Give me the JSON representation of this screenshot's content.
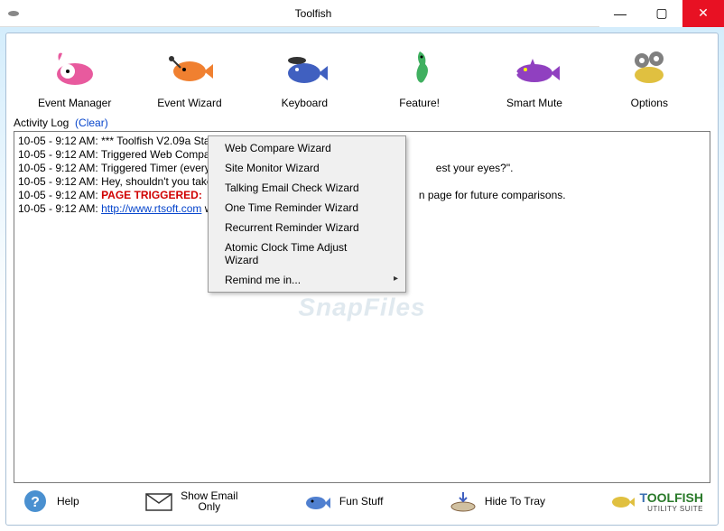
{
  "titlebar": {
    "title": "Toolfish"
  },
  "winbtns": {
    "min": "—",
    "max": "▢",
    "close": "✕"
  },
  "toolbar": [
    {
      "name": "event-manager",
      "label": "Event Manager"
    },
    {
      "name": "event-wizard",
      "label": "Event Wizard"
    },
    {
      "name": "keyboard",
      "label": "Keyboard"
    },
    {
      "name": "feature",
      "label": "Feature!"
    },
    {
      "name": "smart-mute",
      "label": "Smart Mute"
    },
    {
      "name": "options",
      "label": "Options"
    }
  ],
  "loghead": {
    "label": "Activity Log",
    "clear": "(Clear)"
  },
  "log": [
    {
      "ts": "10-05 - 9:12 AM:",
      "msg": "*** Toolfish V2.09a Started"
    },
    {
      "ts": "10-05 - 9:12 AM:",
      "msg": "Triggered Web Compare"
    },
    {
      "ts": "10-05 - 9:12 AM:",
      "msg": "Triggered Timer (every 1",
      "tail": "est your eyes?\"."
    },
    {
      "ts": "10-05 - 9:12 AM:",
      "msg": "Hey, shouldn't you take"
    },
    {
      "ts": "10-05 - 9:12 AM:",
      "trig": "PAGE TRIGGERED:",
      "tail": "n page for future comparisons."
    },
    {
      "ts": "10-05 - 9:12 AM:",
      "link": "http://www.rtsoft.com",
      "msg2": " w"
    }
  ],
  "watermark": "SnapFiles",
  "ctxmenu": [
    {
      "label": "Web Compare Wizard"
    },
    {
      "label": "Site Monitor Wizard"
    },
    {
      "label": "Talking Email Check Wizard"
    },
    {
      "label": "One Time Reminder Wizard"
    },
    {
      "label": "Recurrent Reminder Wizard"
    },
    {
      "label": "Atomic Clock Time Adjust Wizard"
    },
    {
      "label": "Remind me in...",
      "sub": true
    }
  ],
  "bottom": [
    {
      "name": "help",
      "label": "Help"
    },
    {
      "name": "show-email-only",
      "label": "Show Email\nOnly"
    },
    {
      "name": "fun-stuff",
      "label": "Fun Stuff"
    },
    {
      "name": "hide-to-tray",
      "label": "Hide To Tray"
    }
  ],
  "logo": {
    "text": "TOOLFISH",
    "sub": "UTILITY SUITE"
  }
}
